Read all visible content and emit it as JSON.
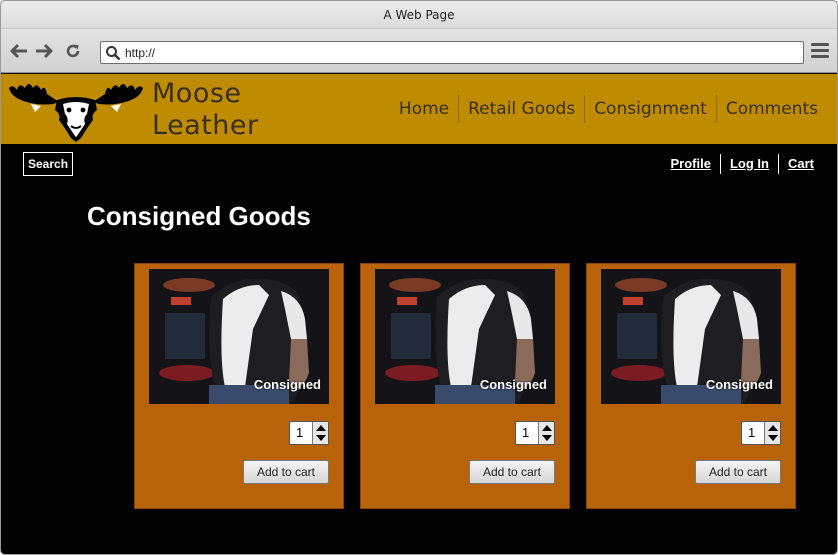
{
  "browser": {
    "window_title": "A Web Page",
    "url": "http://"
  },
  "site": {
    "brand_line1": "Moose",
    "brand_line2": "Leather",
    "nav": [
      "Home",
      "Retail Goods",
      "Consignment",
      "Comments"
    ],
    "search_label": "Search",
    "user_nav": [
      "Profile",
      "Log In",
      "Cart"
    ]
  },
  "colors": {
    "header_bg": "#bf8c00",
    "card_bg": "#b8620a",
    "page_bg": "#000000"
  },
  "page": {
    "title": "Consigned Goods"
  },
  "products": [
    {
      "caption": "Consigned",
      "quantity": "1",
      "add_label": "Add to cart"
    },
    {
      "caption": "Consigned",
      "quantity": "1",
      "add_label": "Add to cart"
    },
    {
      "caption": "Consigned",
      "quantity": "1",
      "add_label": "Add to cart"
    }
  ]
}
